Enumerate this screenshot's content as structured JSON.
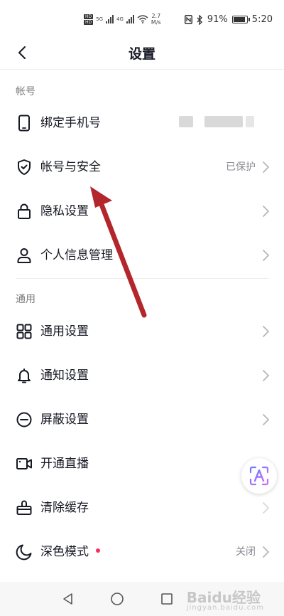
{
  "status_bar": {
    "hd_labels": [
      "HD",
      "HD"
    ],
    "net_labels": [
      "5G",
      "4G"
    ],
    "speed_value": "2.7",
    "speed_unit": "M/s",
    "battery": "91%",
    "time": "5:20"
  },
  "header": {
    "title": "设置"
  },
  "sections": {
    "account_label": "帐号",
    "general_label": "通用"
  },
  "rows": {
    "bind_phone": {
      "label": "绑定手机号"
    },
    "account_security": {
      "label": "帐号与安全",
      "value": "已保护"
    },
    "privacy": {
      "label": "隐私设置"
    },
    "personal_info": {
      "label": "个人信息管理"
    },
    "general_settings": {
      "label": "通用设置"
    },
    "notification": {
      "label": "通知设置"
    },
    "block": {
      "label": "屏蔽设置"
    },
    "live": {
      "label": "开通直播"
    },
    "cache": {
      "label": "清除缓存"
    },
    "dark_mode": {
      "label": "深色模式",
      "value": "关闭"
    }
  },
  "watermark": {
    "text": "Baidu经验",
    "sub": "jingyan.baidu.com"
  },
  "colors": {
    "accent_dot": "#fe2c55",
    "annotation_arrow": "#b3262b",
    "fab_gradient": [
      "#6a7cff",
      "#c86bff"
    ]
  }
}
